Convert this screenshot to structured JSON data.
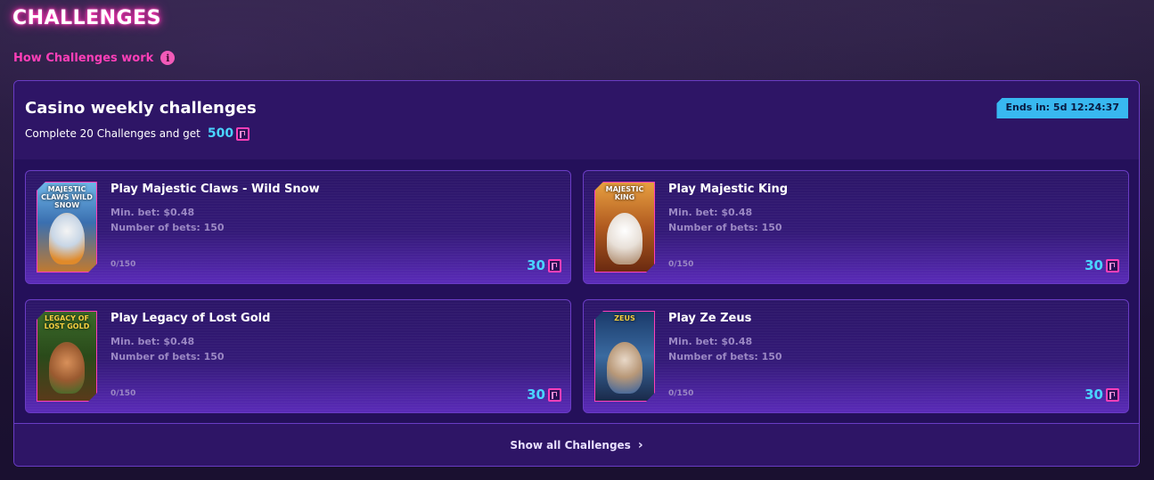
{
  "header": {
    "title": "CHALLENGES",
    "how_link": "How Challenges work",
    "info_icon": "i"
  },
  "panel": {
    "title": "Casino weekly challenges",
    "subtitle": "Complete 20 Challenges and get",
    "total_reward": "500",
    "ends_in": "Ends in: 5d 12:24:37"
  },
  "challenges": [
    {
      "title": "Play Majestic Claws - Wild Snow",
      "thumb_title": "MAJESTIC CLAWS WILD SNOW",
      "min_bet": "Min. bet: $0.48",
      "num_bets": "Number of bets: 150",
      "progress": "0/150",
      "reward": "30"
    },
    {
      "title": "Play Majestic King",
      "thumb_title": "MAJESTIC KING",
      "min_bet": "Min. bet: $0.48",
      "num_bets": "Number of bets: 150",
      "progress": "0/150",
      "reward": "30"
    },
    {
      "title": "Play Legacy of Lost Gold",
      "thumb_title": "LEGACY OF LOST GOLD",
      "min_bet": "Min. bet: $0.48",
      "num_bets": "Number of bets: 150",
      "progress": "0/150",
      "reward": "30"
    },
    {
      "title": "Play Ze Zeus",
      "thumb_title": "ZEUS",
      "min_bet": "Min. bet: $0.48",
      "num_bets": "Number of bets: 150",
      "progress": "0/150",
      "reward": "30"
    }
  ],
  "footer": {
    "show_all": "Show all Challenges"
  },
  "colors": {
    "accent_pink": "#ff3fb8",
    "reward_cyan": "#4ad4ff",
    "panel_purple": "#2a1460",
    "border_purple": "#6a3cc4"
  }
}
